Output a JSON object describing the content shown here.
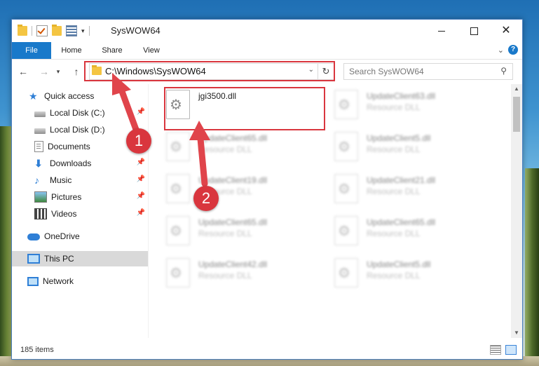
{
  "window": {
    "title": "SysWOW64"
  },
  "ribbon": {
    "tabs": [
      "File",
      "Home",
      "Share",
      "View"
    ],
    "help": "?"
  },
  "navigation": {
    "address_path": "C:\\Windows\\SysWOW64",
    "search_placeholder": "Search SysWOW64"
  },
  "sidebar": {
    "items": [
      {
        "label": "Quick access",
        "icon": "star-icon"
      },
      {
        "label": "Local Disk (C:)",
        "icon": "drive-icon",
        "pinned": true
      },
      {
        "label": "Local Disk (D:)",
        "icon": "drive-icon"
      },
      {
        "label": "Documents",
        "icon": "documents-icon",
        "pinned": true
      },
      {
        "label": "Downloads",
        "icon": "download-icon",
        "pinned": true
      },
      {
        "label": "Music",
        "icon": "music-icon",
        "pinned": true
      },
      {
        "label": "Pictures",
        "icon": "pictures-icon",
        "pinned": true
      },
      {
        "label": "Videos",
        "icon": "videos-icon",
        "pinned": true
      },
      {
        "label": "OneDrive",
        "icon": "cloud-icon"
      },
      {
        "label": "This PC",
        "icon": "computer-icon",
        "selected": true
      },
      {
        "label": "Network",
        "icon": "network-icon"
      }
    ]
  },
  "files": {
    "highlighted": {
      "name": "jgi3500.dll"
    },
    "items": [
      {
        "name": "UpdateClient63.dll",
        "type": "Resource DLL"
      },
      {
        "name": "UpdateClient65.dll",
        "type": "Resource DLL"
      },
      {
        "name": "UpdateClient5.dll",
        "type": "Resource DLL"
      },
      {
        "name": "UpdateClient19.dll",
        "type": "Resource DLL"
      },
      {
        "name": "UpdateClient21.dll",
        "type": "Resource DLL"
      },
      {
        "name": "UpdateClient65.dll",
        "type": "Resource DLL"
      },
      {
        "name": "UpdateClient65.dll",
        "type": "Resource DLL"
      },
      {
        "name": "UpdateClient42.dll",
        "type": "Resource DLL"
      },
      {
        "name": "UpdateClient5.dll",
        "type": "Resource DLL"
      }
    ]
  },
  "status": {
    "item_count": "185 items"
  },
  "annotations": {
    "step1": "1",
    "step2": "2",
    "color": "#d9363e"
  }
}
